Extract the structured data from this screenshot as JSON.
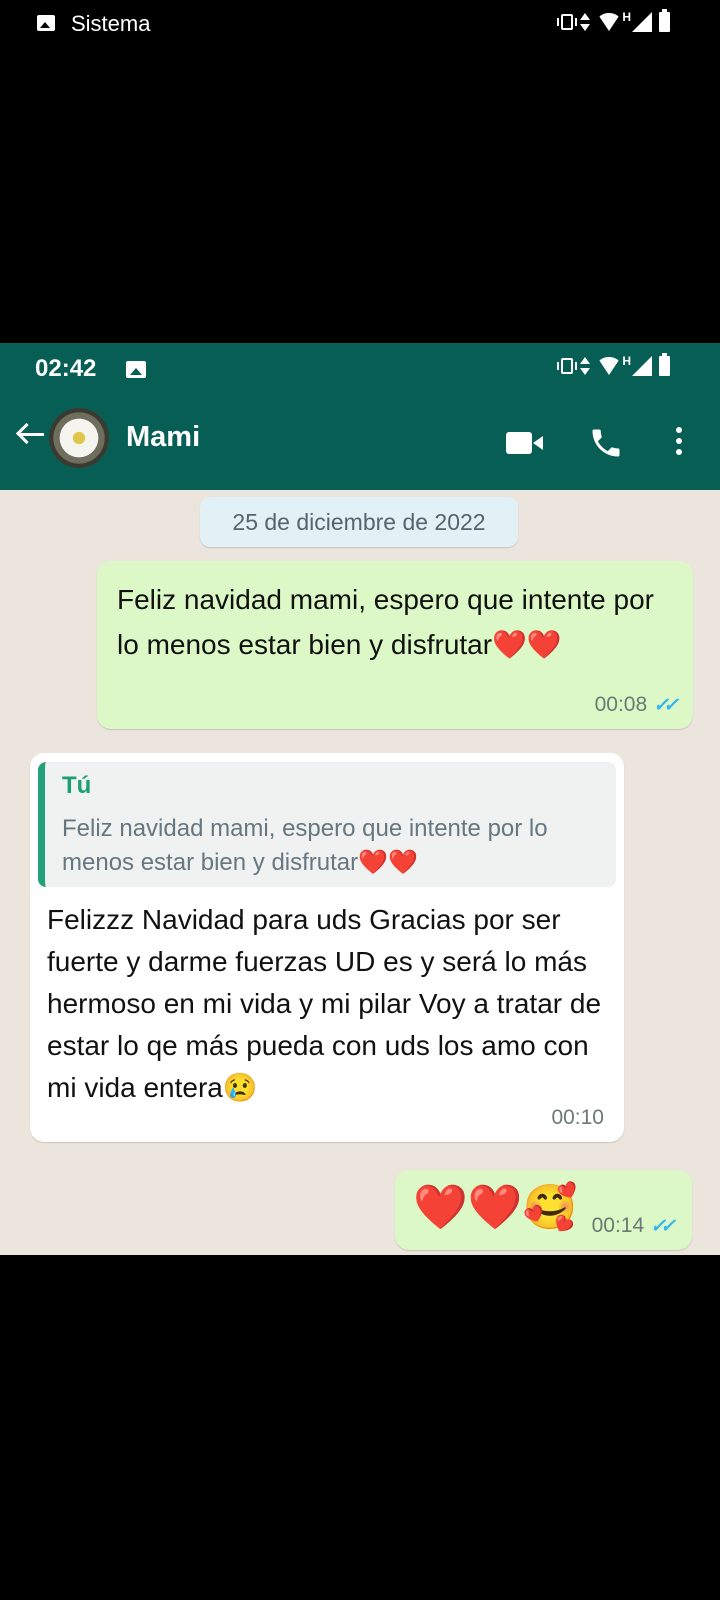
{
  "outer_status": {
    "app_name": "Sistema"
  },
  "inner_status": {
    "time": "02:42",
    "network": "H"
  },
  "header": {
    "contact_name": "Mami"
  },
  "chat": {
    "date": "25 de diciembre de 2022",
    "messages": [
      {
        "direction": "outgoing",
        "text": "Feliz navidad mami, espero que intente por lo menos estar bien y disfrutar❤️❤️",
        "time": "00:08",
        "status": "read"
      },
      {
        "direction": "incoming",
        "quote_author": "Tú",
        "quote_text": "Feliz navidad mami, espero que intente por lo menos estar bien y disfrutar❤️❤️",
        "text": "Felizzz Navidad para uds Gracias por ser fuerte y darme fuerzas UD es y será lo más hermoso en mi vida y mi pilar Voy a tratar de estar lo qe más pueda con uds los amo con mi vida entera😢",
        "time": "00:10"
      },
      {
        "direction": "outgoing",
        "text": "❤️❤️🥰",
        "time": "00:14",
        "status": "read"
      }
    ]
  },
  "colors": {
    "header": "#075e54",
    "outgoing_bubble": "#dcf8c6",
    "incoming_bubble": "#ffffff",
    "chat_background": "#ece5dd",
    "read_ticks": "#34b7f1",
    "quote_accent": "#25a17a"
  },
  "icons": [
    "image-icon",
    "vibrate-icon",
    "data-arrows-icon",
    "wifi-icon",
    "signal-icon",
    "battery-icon",
    "back-arrow-icon",
    "video-call-icon",
    "phone-icon",
    "more-menu-icon",
    "double-check-icon"
  ]
}
